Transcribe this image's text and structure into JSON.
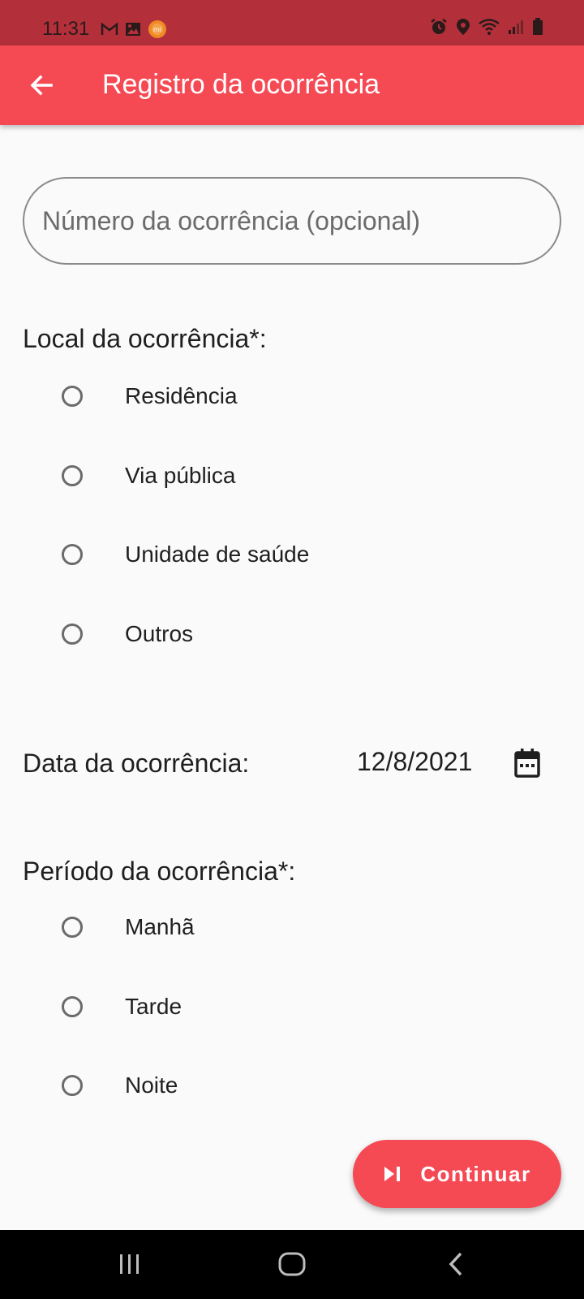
{
  "status_bar": {
    "time": "11:31",
    "left_icons": [
      "gmail-icon",
      "gallery-icon",
      "mi-app-icon"
    ],
    "right_icons": [
      "alarm-icon",
      "location-icon",
      "wifi-icon",
      "signal-icon",
      "battery-icon"
    ],
    "mi_label": "mi"
  },
  "app_bar": {
    "title": "Registro da ocorrência",
    "background": "#f54a54"
  },
  "form": {
    "occurrence_number_placeholder": "Número da ocorrência (opcional)",
    "occurrence_number_value": "",
    "location_label": "Local da ocorrência*:",
    "location_options": [
      "Residência",
      "Via pública",
      "Unidade de saúde",
      "Outros"
    ],
    "date_label": "Data da ocorrência:",
    "date_value": "12/8/2021",
    "period_label": "Período da ocorrência*:",
    "period_options": [
      "Manhã",
      "Tarde",
      "Noite"
    ]
  },
  "actions": {
    "continue_label": "Continuar"
  },
  "colors": {
    "accent": "#f54a54",
    "status_bar": "#b3303b"
  }
}
